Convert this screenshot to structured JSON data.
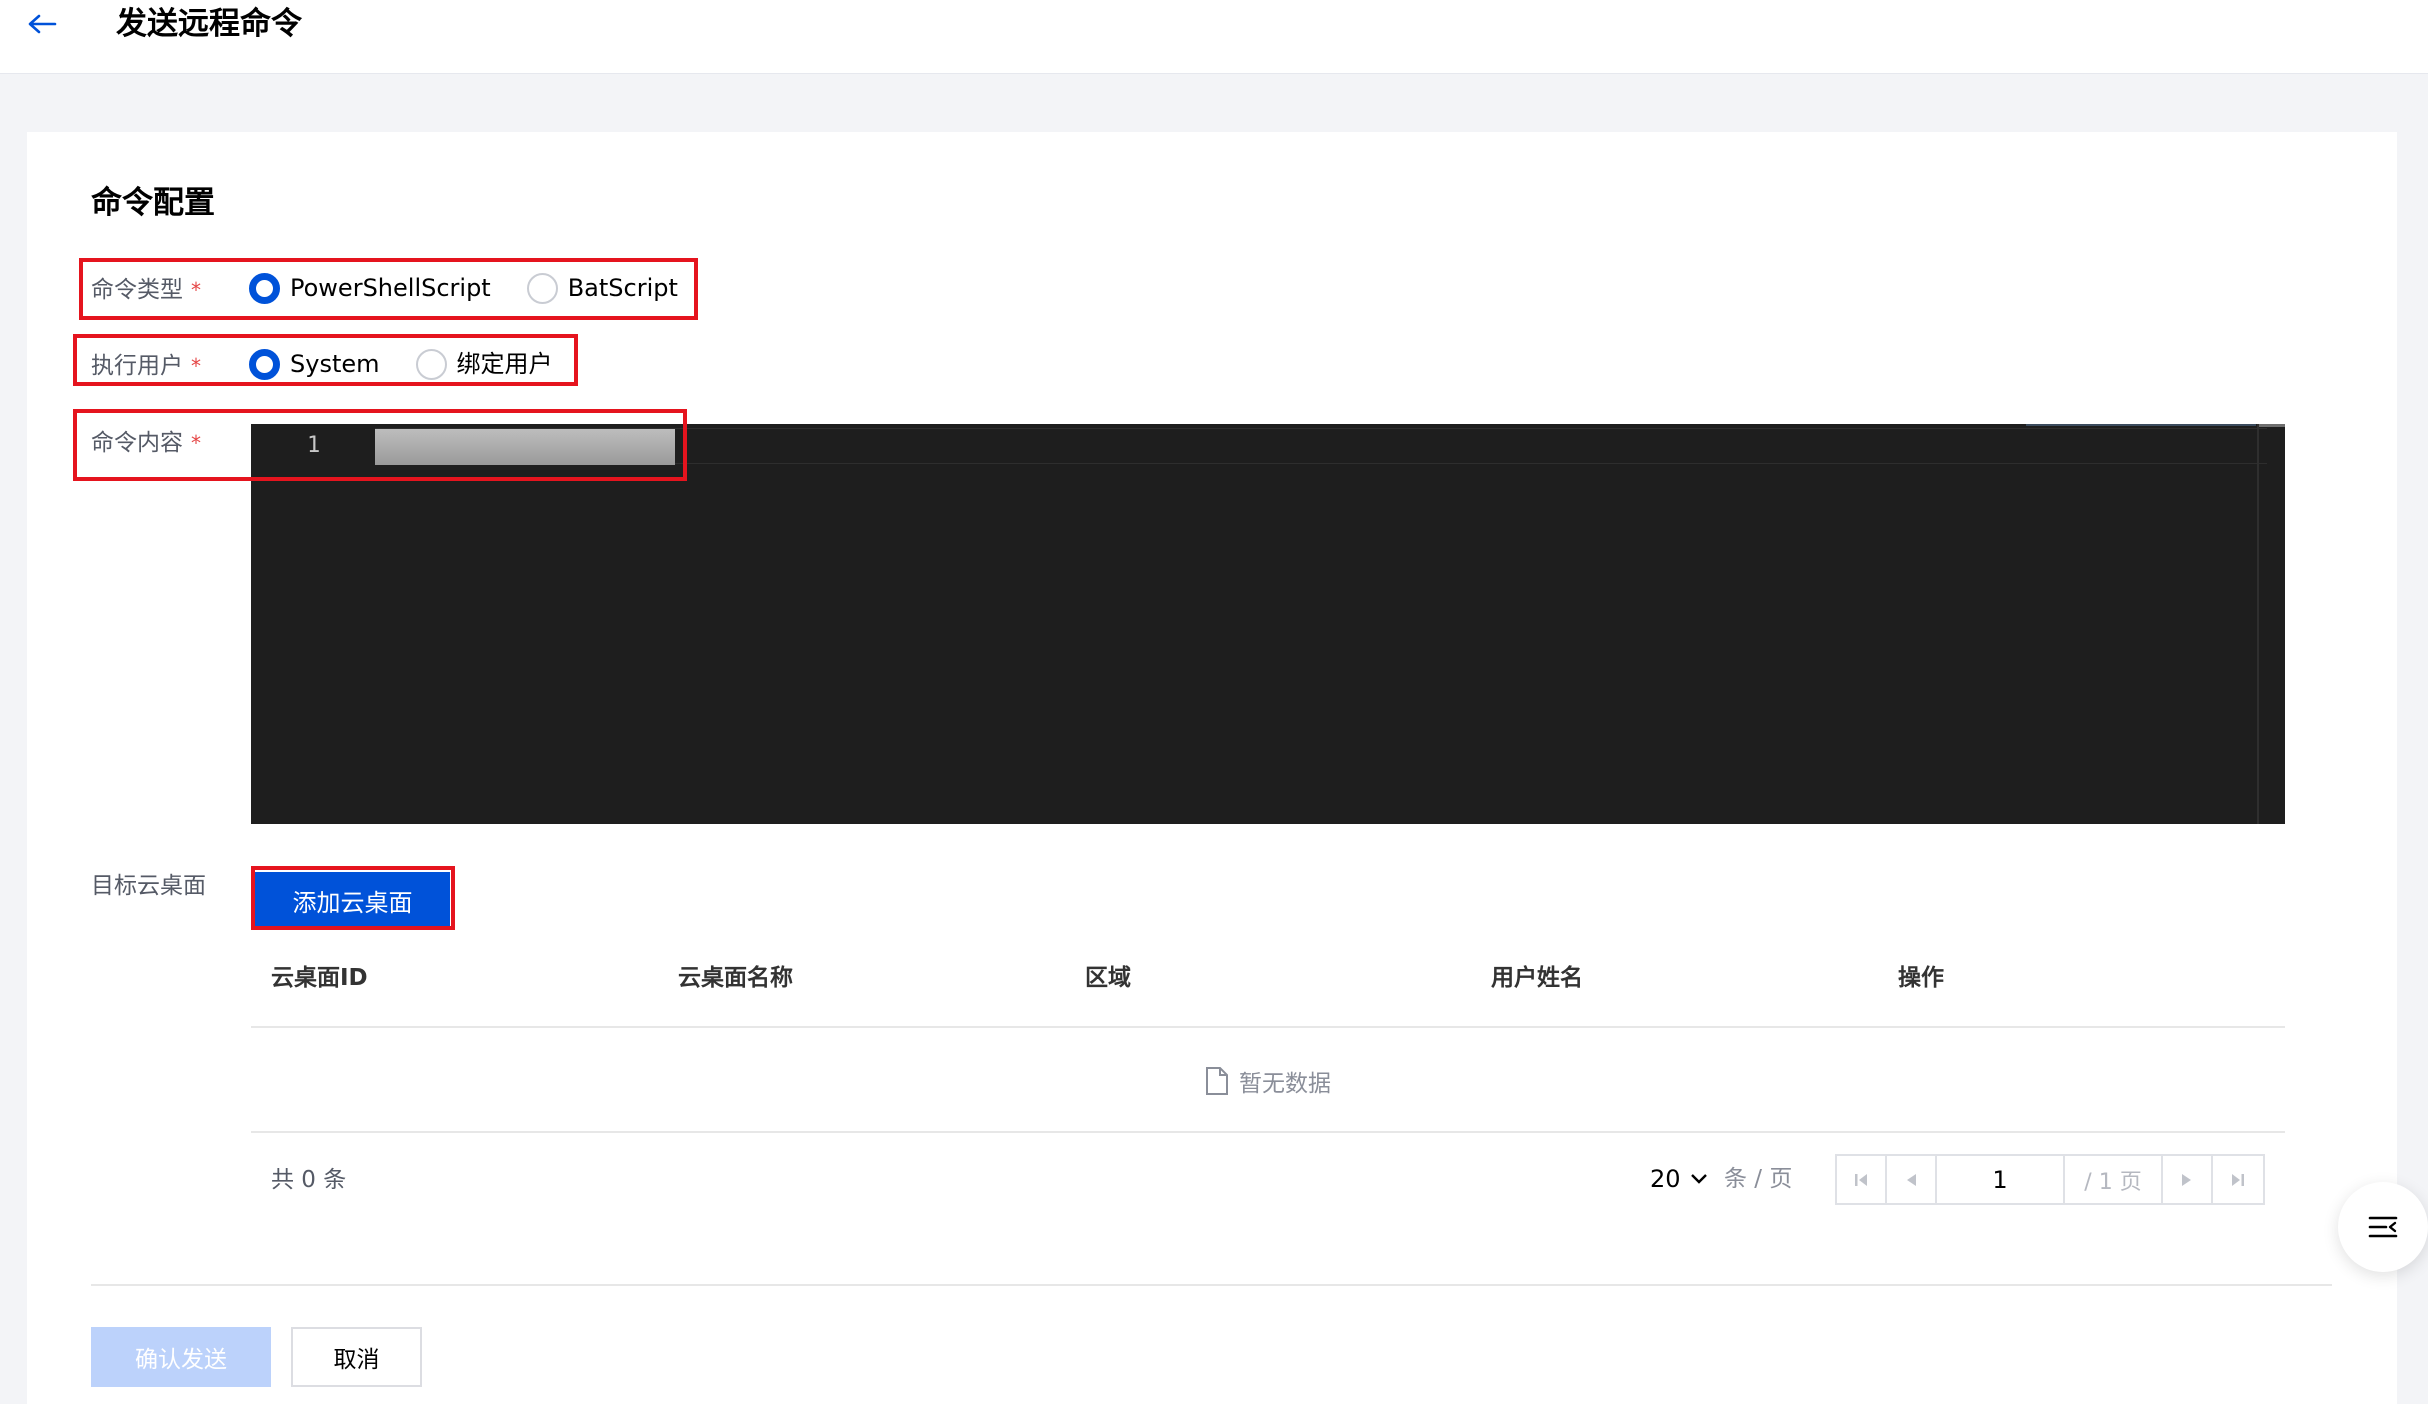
{
  "header": {
    "title": "发送远程命令",
    "back_icon": "arrow-left-icon"
  },
  "section": {
    "title": "命令配置"
  },
  "command_type": {
    "label": "命令类型",
    "required_mark": "*",
    "options": [
      {
        "label": "PowerShellScript",
        "checked": true
      },
      {
        "label": "BatScript",
        "checked": false
      }
    ]
  },
  "exec_user": {
    "label": "执行用户",
    "required_mark": "*",
    "options": [
      {
        "label": "System",
        "checked": true
      },
      {
        "label": "绑定用户",
        "checked": false
      }
    ]
  },
  "command_content": {
    "label": "命令内容",
    "required_mark": "*",
    "line_number": "1"
  },
  "target": {
    "label": "目标云桌面",
    "add_button": "添加云桌面"
  },
  "table": {
    "columns": [
      "云桌面ID",
      "云桌面名称",
      "区域",
      "用户姓名",
      "操作"
    ],
    "empty_text": "暂无数据"
  },
  "pagination": {
    "total_text": "共 0 条",
    "page_size": "20",
    "page_size_unit": "条 / 页",
    "current_page": "1",
    "total_pages": "/ 1 页"
  },
  "footer": {
    "confirm": "确认发送",
    "cancel": "取消"
  },
  "colors": {
    "primary": "#0052d9",
    "danger": "#e5141e",
    "editor_bg": "#1e1e1e"
  }
}
